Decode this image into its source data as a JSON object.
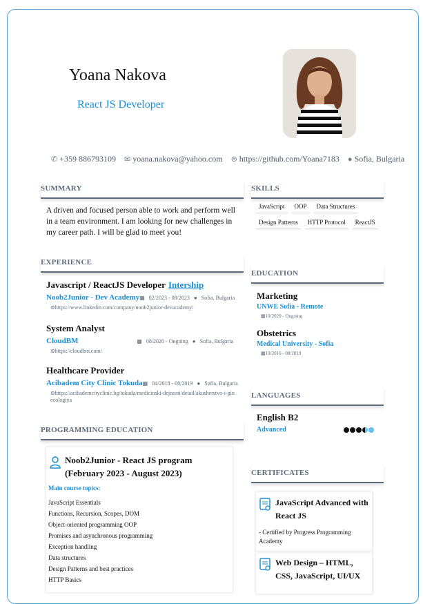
{
  "header": {
    "name": "Yoana Nakova",
    "role": "React JS Developer"
  },
  "contacts": [
    {
      "icon": "phone-icon",
      "text": "+359 886793109"
    },
    {
      "icon": "email-icon",
      "text": "yoana.nakova@yahoo.com"
    },
    {
      "icon": "link-icon",
      "text": "https://github.com/Yoana7183"
    },
    {
      "icon": "location-icon",
      "text": "Sofia, Bulgaria"
    }
  ],
  "sections": {
    "summary": "SUMMARY",
    "experience": "EXPERIENCE",
    "programming_education": "PROGRAMMING EDUCATION",
    "skills": "SKILLS",
    "education": "EDUCATION",
    "languages": "LANGUAGES",
    "certificates": "CERTIFICATES"
  },
  "summary": "A driven and focused person able to work and perform well in a team environment. I am looking for new challenges in my career path. I will be glad to meet you!",
  "experience": [
    {
      "title": "Javascript / ReactJS Developer",
      "tag": "Intership",
      "company": "Noob2Junior - Dev Academy",
      "dates": "02/2023 - 08/2023",
      "location": "Sofia, Bulgaria",
      "link": "https://www.linkedin.com/company/noob2junior-devacademy/"
    },
    {
      "title": "System Analyst",
      "tag": "",
      "company": "CloudBM",
      "dates": "08/2020 - Ongoing",
      "location": "Sofia, Bulgaria",
      "link": "https://cloudbm.com/"
    },
    {
      "title": "Healthcare Provider",
      "tag": "",
      "company": "Acibadem City Clinic Tokuda",
      "dates": "04/2018 - 08/2019",
      "location": "Sofia, Bulgaria",
      "link": "https://acibademcityclinic.bg/tokuda/medicinski-dejnosti/detail/akusherstvo-i-ginecologiya"
    }
  ],
  "programming": {
    "title": "Noob2Junior - React JS program (February 2023 - August 2023)",
    "topics_label": "Main course topics:",
    "topics": [
      "JavaScript Essentials",
      "Functions, Recursion, Scopes, DOM",
      "Object-oriented programming OOP",
      "Promises and asynchronous programming",
      "Exception handling",
      "Data structures",
      "Design Patterns and best practices",
      "HTTP Basics"
    ]
  },
  "skills": [
    "JavaScript",
    "OOP",
    "Data Structures",
    "Design Patterns",
    "HTTP Protocol",
    "ReactJS"
  ],
  "education": [
    {
      "title": "Marketing",
      "school": "UNWE Sofia - Remote",
      "dates": "10/2020 - Ongoing"
    },
    {
      "title": "Obstetrics",
      "school": "Medical University - Sofia",
      "dates": "10/2016 - 08/2019"
    }
  ],
  "language": {
    "name": "English B2",
    "level": "Advanced",
    "rating": 0.7
  },
  "certificates": [
    {
      "title": "JavaScript Advanced with React JS",
      "by": "- Certified by Progress Programming Academy"
    },
    {
      "title": "Web Design – HTML, CSS, JavaScript, UI/UX",
      "by": ""
    }
  ],
  "colors": {
    "accent": "#1a8fd8",
    "heading": "#5b6b7a",
    "border": "#4aa3d8"
  }
}
